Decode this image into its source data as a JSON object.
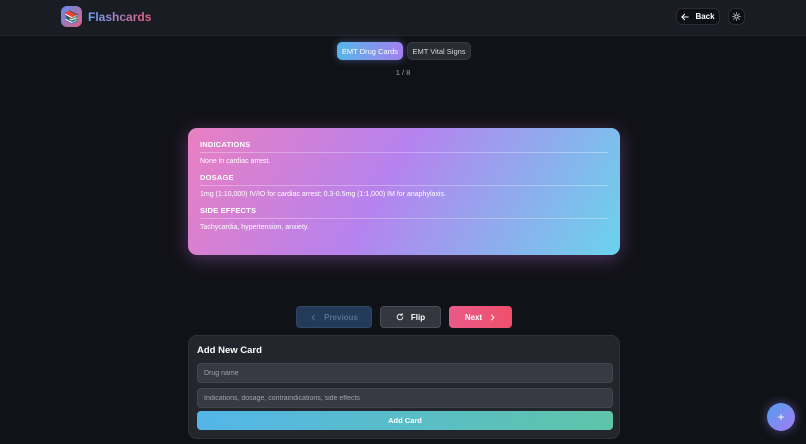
{
  "header": {
    "logo_emoji": "📚",
    "brand": "Flashcards",
    "back_label": "Back"
  },
  "tabs": [
    {
      "label": "EMT Drug Cards",
      "active": true
    },
    {
      "label": "EMT Vital Signs",
      "active": false
    }
  ],
  "counter": "1 / 8",
  "card": {
    "sections": [
      {
        "heading": "INDICATIONS",
        "text": "None in cardiac arrest."
      },
      {
        "heading": "DOSAGE",
        "text": "1mg (1:10,000) IV/IO for cardiac arrest; 0.3-0.5mg (1:1,000) IM for anaphylaxis."
      },
      {
        "heading": "SIDE EFFECTS",
        "text": "Tachycardia, hypertension, anxiety."
      }
    ]
  },
  "controls": {
    "previous_label": "Previous",
    "flip_label": "Flip",
    "next_label": "Next"
  },
  "add_card": {
    "title": "Add New Card",
    "name_placeholder": "Drug name",
    "details_placeholder": "Indications, dosage, contraindications, side effects",
    "submit_label": "Add Card"
  },
  "fab_label": "+",
  "colors": {
    "background": "#111217",
    "accent_blue": "#54b6e8",
    "accent_purple": "#a47ff0",
    "accent_pink": "#e85a8a"
  }
}
